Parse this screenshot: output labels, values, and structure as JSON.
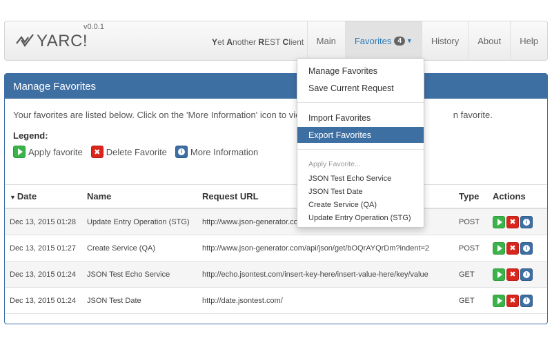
{
  "app": {
    "name": "YARC!",
    "version": "v0.0.1",
    "tagline_parts": [
      "Y",
      "et ",
      "A",
      "nother ",
      "R",
      "EST ",
      "C",
      "lient"
    ]
  },
  "nav": {
    "items": [
      {
        "label": "Main"
      },
      {
        "label": "Favorites",
        "badge": "4",
        "active": true
      },
      {
        "label": "History"
      },
      {
        "label": "About"
      },
      {
        "label": "Help"
      }
    ]
  },
  "panel": {
    "title": "Manage Favorites",
    "intro_before": "Your favorites are listed below. Click on the 'More Information' icon to view",
    "intro_after": "n favorite.",
    "legend_title": "Legend:",
    "legend": {
      "apply": "Apply favorite",
      "delete": "Delete Favorite",
      "info": "More Information"
    }
  },
  "table": {
    "headers": {
      "date": "Date",
      "name": "Name",
      "url": "Request URL",
      "type": "Type",
      "actions": "Actions"
    },
    "rows": [
      {
        "date": "Dec 13, 2015 01:28",
        "name": "Update Entry Operation (STG)",
        "url": "http://www.json-generator.com/",
        "type": "POST"
      },
      {
        "date": "Dec 13, 2015 01:27",
        "name": "Create Service (QA)",
        "url": "http://www.json-generator.com/api/json/get/bOQrAYQrDm?indent=2",
        "type": "POST"
      },
      {
        "date": "Dec 13, 2015 01:24",
        "name": "JSON Test Echo Service",
        "url": "http://echo.jsontest.com/insert-key-here/insert-value-here/key/value",
        "type": "GET"
      },
      {
        "date": "Dec 13, 2015 01:24",
        "name": "JSON Test Date",
        "url": "http://date.jsontest.com/",
        "type": "GET"
      }
    ]
  },
  "dropdown": {
    "manage": "Manage Favorites",
    "save": "Save Current Request",
    "import": "Import Favorites",
    "export": "Export Favorites",
    "apply_header": "Apply Favorite...",
    "favorites": [
      "JSON Test Echo Service",
      "JSON Test Date",
      "Create Service (QA)",
      "Update Entry Operation (STG)"
    ]
  },
  "icons": {
    "logo": "yarc-logo-icon",
    "apply": "play-icon",
    "delete": "close-icon",
    "info": "info-icon",
    "sort": "sort-desc-icon",
    "dropdown_caret": "caret-down-icon"
  },
  "colors": {
    "primary": "#3e6fa3",
    "apply": "#3bb34a",
    "delete": "#d9251c",
    "active_nav_text": "#2a7ab8"
  }
}
